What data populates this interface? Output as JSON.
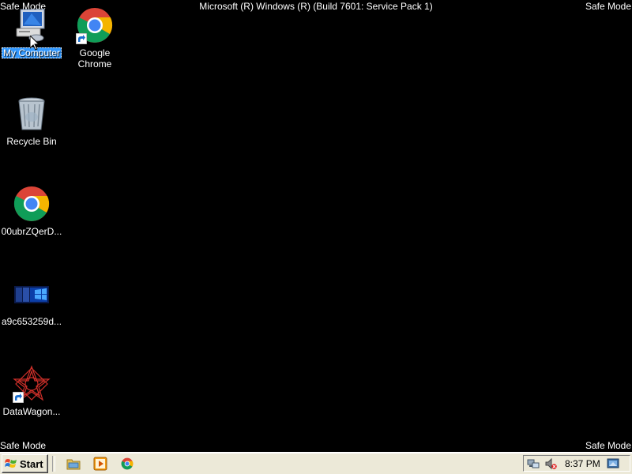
{
  "desktop": {
    "safe_mode_label": "Safe Mode",
    "build_label": "Microsoft (R) Windows (R) (Build 7601: Service Pack 1)",
    "background_color": "#000000",
    "selection_color": "#3399ff",
    "icons": {
      "my_computer": {
        "label": "My Computer",
        "icon": "computer-icon",
        "selected": true
      },
      "google_chrome": {
        "label": "Google Chrome",
        "icon": "chrome-icon",
        "shortcut": true
      },
      "recycle_bin": {
        "label": "Recycle Bin",
        "icon": "recycle-bin-icon"
      },
      "chrome_file": {
        "label": "00ubrZQerD...",
        "icon": "chrome-icon"
      },
      "image_file": {
        "label": "a9c653259d...",
        "icon": "image-thumbnail-icon"
      },
      "datawagon": {
        "label": "DataWagon...",
        "icon": "datawagon-star-icon",
        "shortcut": true
      }
    }
  },
  "taskbar": {
    "start_label": "Start",
    "quick_launch": [
      "explorer-folder-icon",
      "media-player-icon",
      "chrome-icon"
    ],
    "tray": {
      "icons": [
        "network-icon",
        "volume-muted-icon"
      ],
      "clock": "8:37 PM",
      "show_desktop_icon": "show-desktop-icon"
    }
  }
}
